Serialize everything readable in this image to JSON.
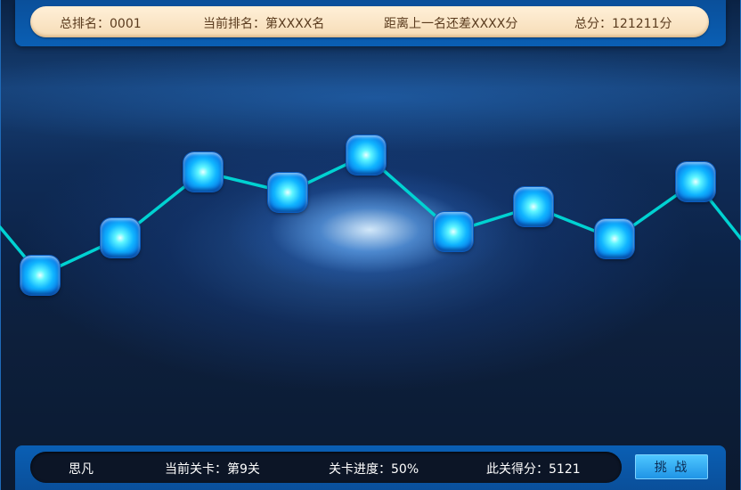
{
  "top_bar": {
    "total_rank": "总排名：0001",
    "current_rank": "当前排名：第XXXX名",
    "gap_to_prev": "距离上一名还差XXXX分",
    "total_score": "总分：121211分"
  },
  "level_path": {
    "line_color": "#00d2d2",
    "node_color": "#10b4ff",
    "node_count": 9
  },
  "bottom_bar": {
    "player_name": "思凡",
    "current_level": "当前关卡：第9关",
    "level_progress": "关卡进度：50%",
    "level_score": "此关得分：5121",
    "challenge_button": "挑 战"
  }
}
